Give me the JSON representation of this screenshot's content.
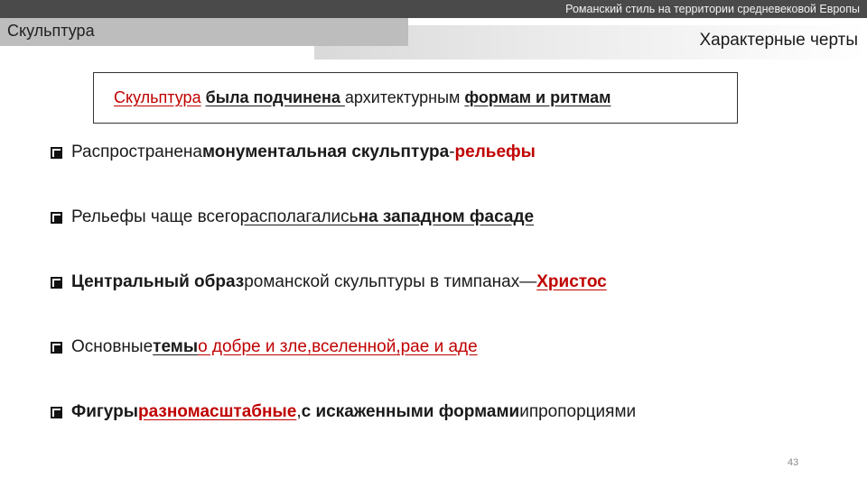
{
  "header": {
    "presentation_title": "Романский стиль на территории средневековой Европы",
    "section_tab": "Скульптура",
    "slide_heading": "Характерные черты"
  },
  "framed_statement": {
    "part1": "Скульптура",
    "part2": " ",
    "part3": "была подчинена ",
    "part4": "архитектурным ",
    "part5": "формам и ритмам"
  },
  "bullets": [
    {
      "t1": "Распространена ",
      "t2": "монументальная скульптура",
      "t3": "-",
      "t4": "рельефы"
    },
    {
      "t1": "Рельефы чаще всего ",
      "t2": "располагались ",
      "t3": "на западном фасаде"
    },
    {
      "t1": "Центральный образ",
      "t2": " романской скульптуры в тимпанах ",
      "t3": "— ",
      "t4": "Христос"
    },
    {
      "t1": "Основные ",
      "t2": "темы",
      "t3": " о добре и зле,вселенной,рае и аде"
    },
    {
      "t1": "Фигуры ",
      "t2": "разномасштабные",
      "t3": ", ",
      "t4": "с искаженными формами",
      "t5": " и ",
      "t6": "пропорциями"
    }
  ],
  "page_number": "43",
  "colors": {
    "accent_red": "#c00000",
    "header_bar": "#4a4a4a",
    "tab_gray": "#bdbdbd"
  },
  "icons": {
    "bullet": "checkbox-bullet-icon"
  }
}
